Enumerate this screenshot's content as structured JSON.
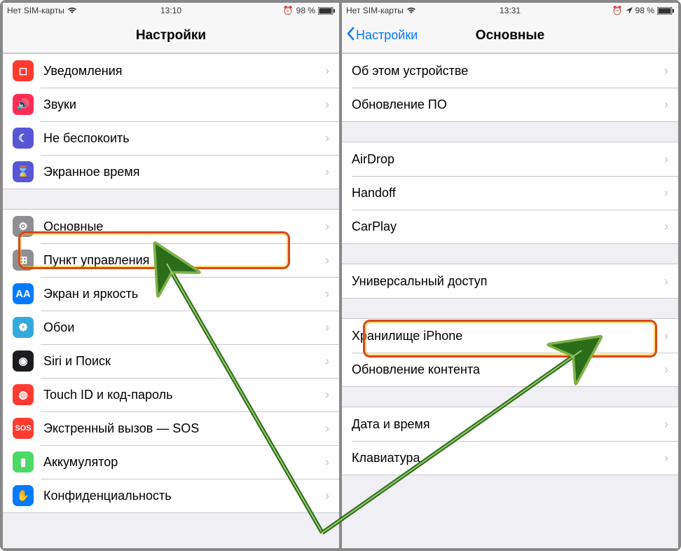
{
  "left": {
    "status": {
      "carrier": "Нет SIM-карты",
      "time": "13:10",
      "battery": "98 %"
    },
    "nav": {
      "title": "Настройки"
    },
    "groups": [
      {
        "rows": [
          {
            "icon": "notifications-icon",
            "color": "ic-red",
            "glyph": "◻︎",
            "label": "Уведомления"
          },
          {
            "icon": "sounds-icon",
            "color": "ic-pink",
            "glyph": "🔊",
            "label": "Звуки"
          },
          {
            "icon": "dnd-icon",
            "color": "ic-purple",
            "glyph": "☾",
            "label": "Не беспокоить"
          },
          {
            "icon": "screentime-icon",
            "color": "ic-purple",
            "glyph": "⌛",
            "label": "Экранное время"
          }
        ]
      },
      {
        "rows": [
          {
            "icon": "general-icon",
            "color": "ic-grey",
            "glyph": "⚙",
            "label": "Основные"
          },
          {
            "icon": "controlcenter-icon",
            "color": "ic-grey",
            "glyph": "⊞",
            "label": "Пункт управления"
          },
          {
            "icon": "display-icon",
            "color": "ic-blue",
            "glyph": "AA",
            "label": "Экран и яркость"
          },
          {
            "icon": "wallpaper-icon",
            "color": "ic-cyan",
            "glyph": "❁",
            "label": "Обои"
          },
          {
            "icon": "siri-icon",
            "color": "ic-black",
            "glyph": "◉",
            "label": "Siri и Поиск"
          },
          {
            "icon": "touchid-icon",
            "color": "ic-red",
            "glyph": "◍",
            "label": "Touch ID и код-пароль"
          },
          {
            "icon": "sos-icon",
            "color": "ic-sos",
            "glyph": "SOS",
            "label": "Экстренный вызов — SOS"
          },
          {
            "icon": "battery-icon",
            "color": "ic-green",
            "glyph": "▮",
            "label": "Аккумулятор"
          },
          {
            "icon": "privacy-icon",
            "color": "ic-blue",
            "glyph": "✋",
            "label": "Конфиденциальность"
          }
        ]
      }
    ]
  },
  "right": {
    "status": {
      "carrier": "Нет SIM-карты",
      "time": "13:31",
      "battery": "98 %"
    },
    "nav": {
      "back": "Настройки",
      "title": "Основные"
    },
    "groups": [
      {
        "rows": [
          {
            "label": "Об этом устройстве"
          },
          {
            "label": "Обновление ПО"
          }
        ]
      },
      {
        "rows": [
          {
            "label": "AirDrop"
          },
          {
            "label": "Handoff"
          },
          {
            "label": "CarPlay"
          }
        ]
      },
      {
        "rows": [
          {
            "label": "Универсальный доступ"
          }
        ]
      },
      {
        "rows": [
          {
            "label": "Хранилище iPhone"
          },
          {
            "label": "Обновление контента"
          }
        ]
      },
      {
        "rows": [
          {
            "label": "Дата и время"
          },
          {
            "label": "Клавиатура"
          }
        ]
      }
    ]
  },
  "highlights": {
    "left_general": true,
    "right_accessibility": true
  }
}
